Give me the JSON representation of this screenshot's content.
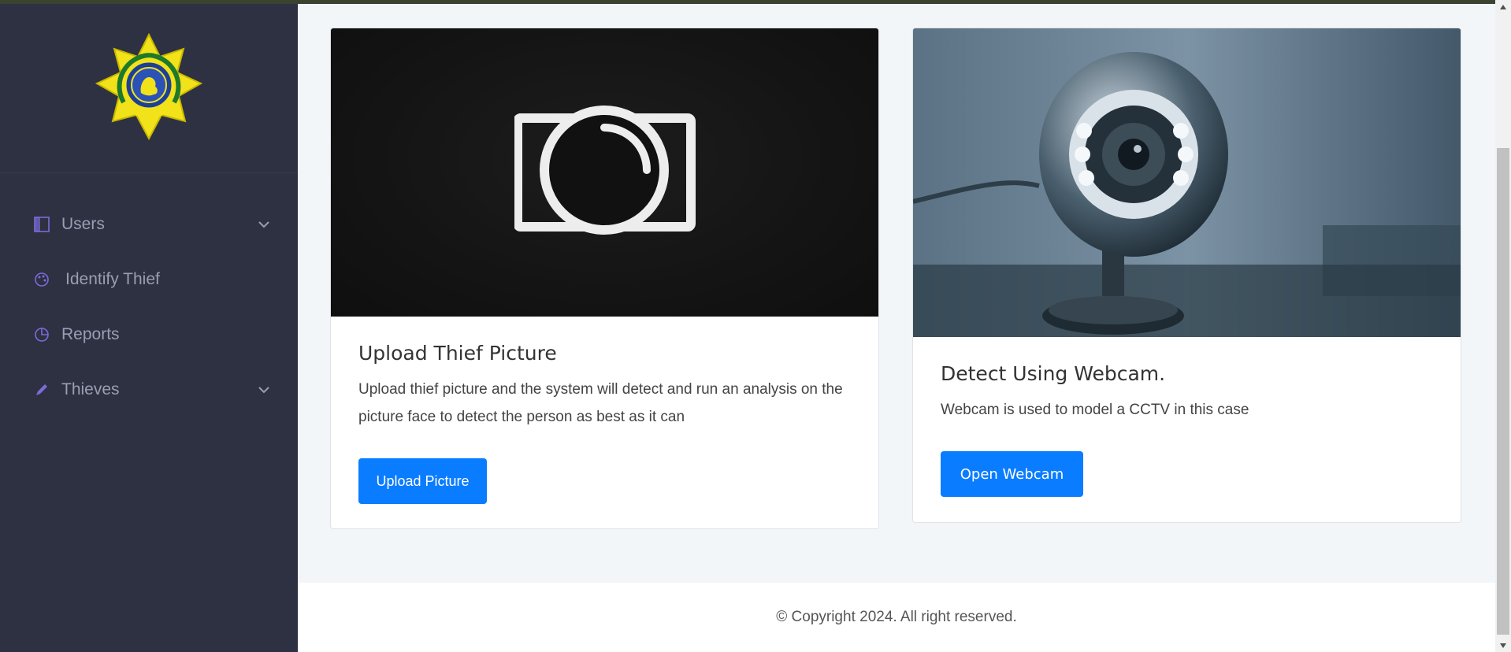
{
  "sidebar": {
    "logo": "police-badge-logo",
    "items": [
      {
        "label": "Users",
        "icon": "panel-icon",
        "has_submenu": true
      },
      {
        "label": "Identify Thief",
        "icon": "palette-icon",
        "has_submenu": false
      },
      {
        "label": "Reports",
        "icon": "pie-chart-icon",
        "has_submenu": false
      },
      {
        "label": "Thieves",
        "icon": "pencil-icon",
        "has_submenu": true
      }
    ]
  },
  "cards": [
    {
      "image": "camera-icon",
      "title": "Upload Thief Picture",
      "text": "Upload thief picture and the system will detect and run an analysis on the picture face to detect the person as best as it can",
      "button": "Upload Picture"
    },
    {
      "image": "webcam-photo",
      "title": "Detect Using Webcam.",
      "text": "Webcam is used to model a CCTV in this case",
      "button": "Open Webcam"
    }
  ],
  "footer": {
    "copyright": "© Copyright 2024. All right reserved."
  },
  "colors": {
    "sidebar_bg": "#2d3142",
    "accent": "#0a7cff",
    "icon_accent": "#7c6cd8"
  }
}
